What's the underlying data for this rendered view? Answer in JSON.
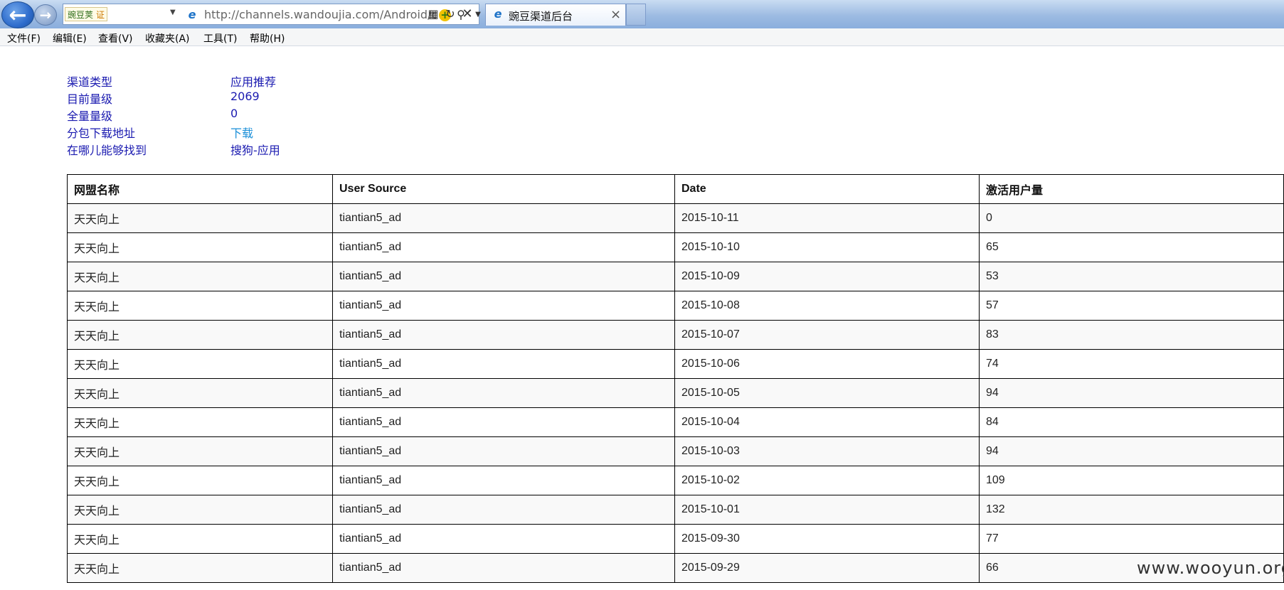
{
  "browser": {
    "site_badge": "豌豆荚",
    "cert_badge": "证",
    "url": "http://channels.wandoujia.com/Android/daily",
    "tab_title": "豌豆渠道后台",
    "tab_close": "×"
  },
  "menu": [
    "文件(F)",
    "编辑(E)",
    "查看(V)",
    "收藏夹(A)",
    "工具(T)",
    "帮助(H)"
  ],
  "info": [
    {
      "label": "渠道类型",
      "value": "应用推荐"
    },
    {
      "label": "目前量级",
      "value": "2069"
    },
    {
      "label": "全量量级",
      "value": "0"
    },
    {
      "label": "分包下载地址",
      "value": "下载"
    },
    {
      "label": "在哪儿能够找到",
      "value": "搜狗-应用"
    }
  ],
  "table": {
    "headers": [
      "网盟名称",
      "User Source",
      "Date",
      "激活用户量"
    ],
    "rows": [
      [
        "天天向上",
        "tiantian5_ad",
        "2015-10-11",
        "0"
      ],
      [
        "天天向上",
        "tiantian5_ad",
        "2015-10-10",
        "65"
      ],
      [
        "天天向上",
        "tiantian5_ad",
        "2015-10-09",
        "53"
      ],
      [
        "天天向上",
        "tiantian5_ad",
        "2015-10-08",
        "57"
      ],
      [
        "天天向上",
        "tiantian5_ad",
        "2015-10-07",
        "83"
      ],
      [
        "天天向上",
        "tiantian5_ad",
        "2015-10-06",
        "74"
      ],
      [
        "天天向上",
        "tiantian5_ad",
        "2015-10-05",
        "94"
      ],
      [
        "天天向上",
        "tiantian5_ad",
        "2015-10-04",
        "84"
      ],
      [
        "天天向上",
        "tiantian5_ad",
        "2015-10-03",
        "94"
      ],
      [
        "天天向上",
        "tiantian5_ad",
        "2015-10-02",
        "109"
      ],
      [
        "天天向上",
        "tiantian5_ad",
        "2015-10-01",
        "132"
      ],
      [
        "天天向上",
        "tiantian5_ad",
        "2015-09-30",
        "77"
      ],
      [
        "天天向上",
        "tiantian5_ad",
        "2015-09-29",
        "66"
      ]
    ]
  },
  "watermark": "www.wooyun.org"
}
